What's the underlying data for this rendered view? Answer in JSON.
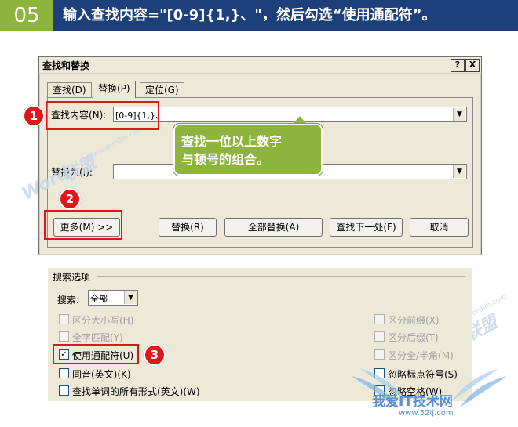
{
  "header": {
    "step": "05",
    "instruction": "输入查找内容=\"[0-9]{1,}、\"，然后勾选“使用通配符”。"
  },
  "dialog": {
    "title": "查找和替换",
    "help_btn": "?",
    "close_btn": "X",
    "tabs": [
      {
        "label": "查找(D)"
      },
      {
        "label": "替换(P)"
      },
      {
        "label": "定位(G)"
      }
    ],
    "find_label": "查找内容(N):",
    "find_value": "[0-9]{1,}、",
    "replace_label": "替换为(I):",
    "replace_value": "",
    "buttons": {
      "more": "更多(M) >>",
      "replace": "替换(R)",
      "replace_all": "全部替换(A)",
      "find_next": "查找下一处(F)",
      "cancel": "取消"
    }
  },
  "callout": {
    "line1": "查找一位以上数字",
    "line2": "与顿号的组合。"
  },
  "markers": [
    "1",
    "2",
    "3"
  ],
  "options": {
    "group_title": "搜索选项",
    "search_label": "搜索:",
    "search_value": "全部",
    "checkboxes": {
      "match_case": {
        "label": "区分大小写(H)",
        "checked": false
      },
      "whole_word": {
        "label": "全字匹配(Y)",
        "checked": false
      },
      "wildcards": {
        "label": "使用通配符(U)",
        "checked": true
      },
      "sounds_like": {
        "label": "同音(英文)(K)",
        "checked": false
      },
      "all_forms": {
        "label": "查找单词的所有形式(英文)(W)",
        "checked": false
      },
      "match_prefix": {
        "label": "区分前缀(X)",
        "checked": false
      },
      "match_suffix": {
        "label": "区分后缀(T)",
        "checked": false
      },
      "full_half_width": {
        "label": "区分全/半角(M)",
        "checked": false
      },
      "ignore_punct": {
        "label": "忽略标点符号(S)",
        "checked": false
      },
      "ignore_space": {
        "label": "忽略空格(W)",
        "checked": false
      }
    }
  },
  "watermarks": {
    "word": "Word",
    "lianmeng": "联盟",
    "site": "www.wordlm.com"
  },
  "logo": {
    "main": "我爱IT技术网",
    "url": "www.52ij.com"
  },
  "colors": {
    "banner_blue": "#1d3f7a",
    "step_green": "#8db43c",
    "highlight_red": "#e0161b",
    "dialog_bg": "#ece9d8"
  }
}
